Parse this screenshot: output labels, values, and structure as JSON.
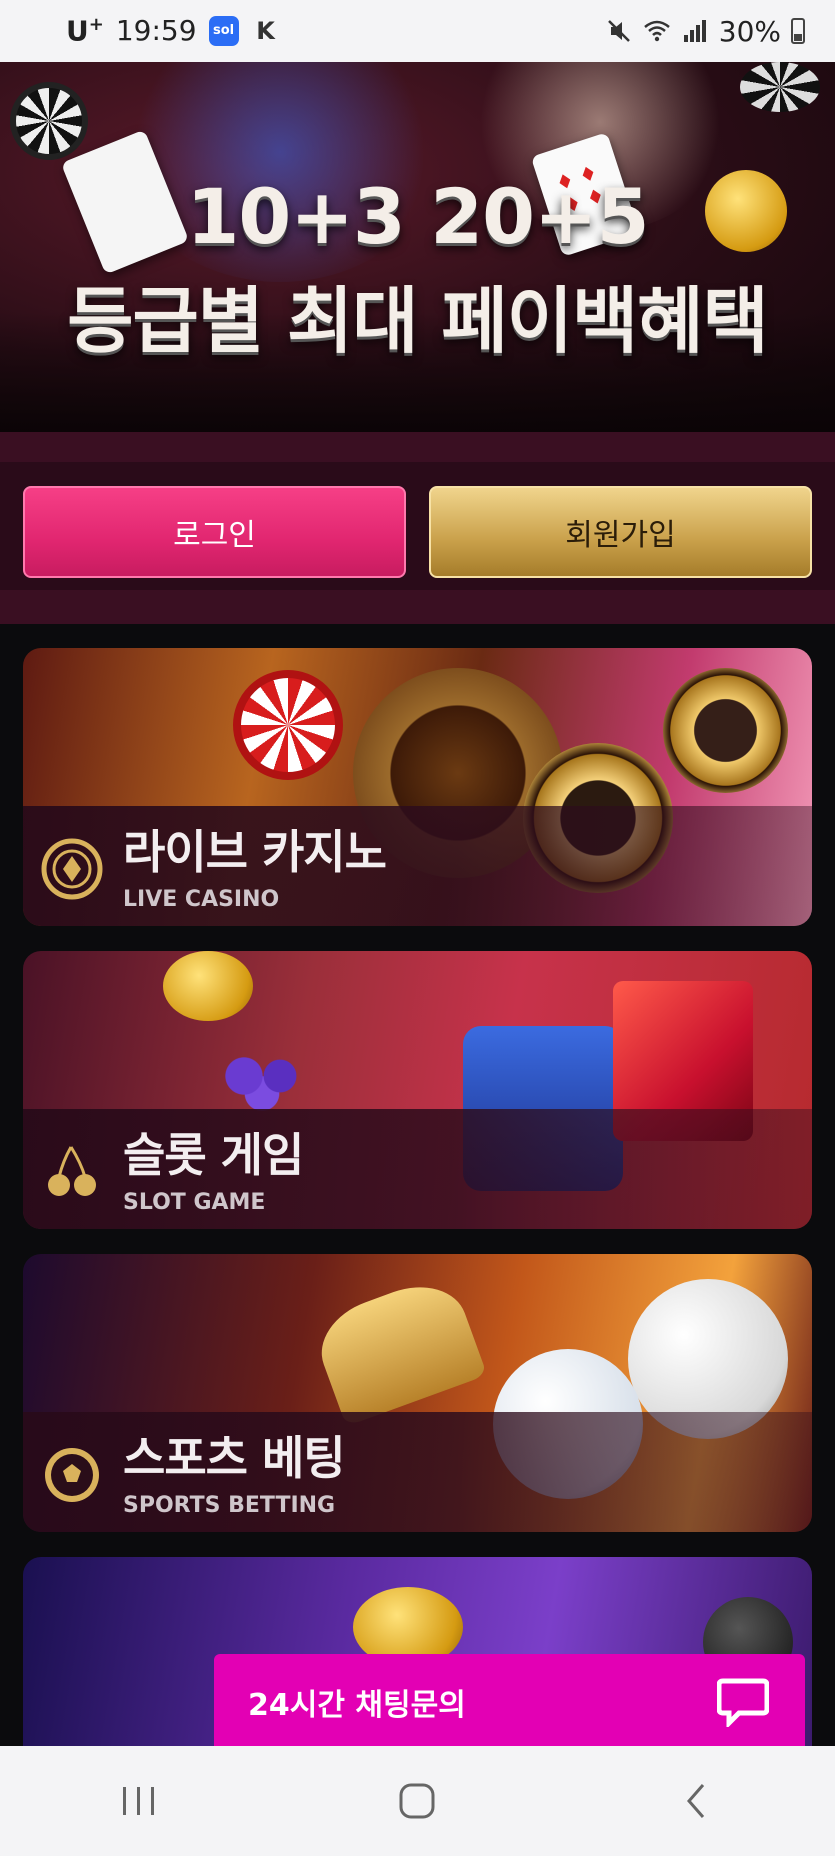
{
  "status_bar": {
    "carrier": "U",
    "carrier_plus": "+",
    "time": "19:59",
    "app_badge_1": "sol",
    "app_badge_2": "K",
    "battery": "30%"
  },
  "hero": {
    "line1": "10+3 20+5",
    "line2": "등급별 최대 페이백혜택"
  },
  "auth": {
    "login_label": "로그인",
    "signup_label": "회원가입"
  },
  "categories": [
    {
      "title_ko": "라이브 카지노",
      "title_en": "LIVE CASINO",
      "icon": "casino-chip-icon"
    },
    {
      "title_ko": "슬롯 게임",
      "title_en": "SLOT GAME",
      "icon": "cherry-icon"
    },
    {
      "title_ko": "스포츠 베팅",
      "title_en": "SPORTS BETTING",
      "icon": "soccer-ball-icon"
    }
  ],
  "chat": {
    "label": "24시간 채팅문의",
    "icon": "chat-bubble-icon"
  },
  "nav": {
    "recents_icon": "recents-icon",
    "home_icon": "home-icon",
    "back_icon": "back-icon"
  },
  "colors": {
    "login_pink": "#e12670",
    "signup_gold": "#c9a04a",
    "chat_magenta": "#e300b4",
    "band_maroon": "#3a0f22"
  }
}
